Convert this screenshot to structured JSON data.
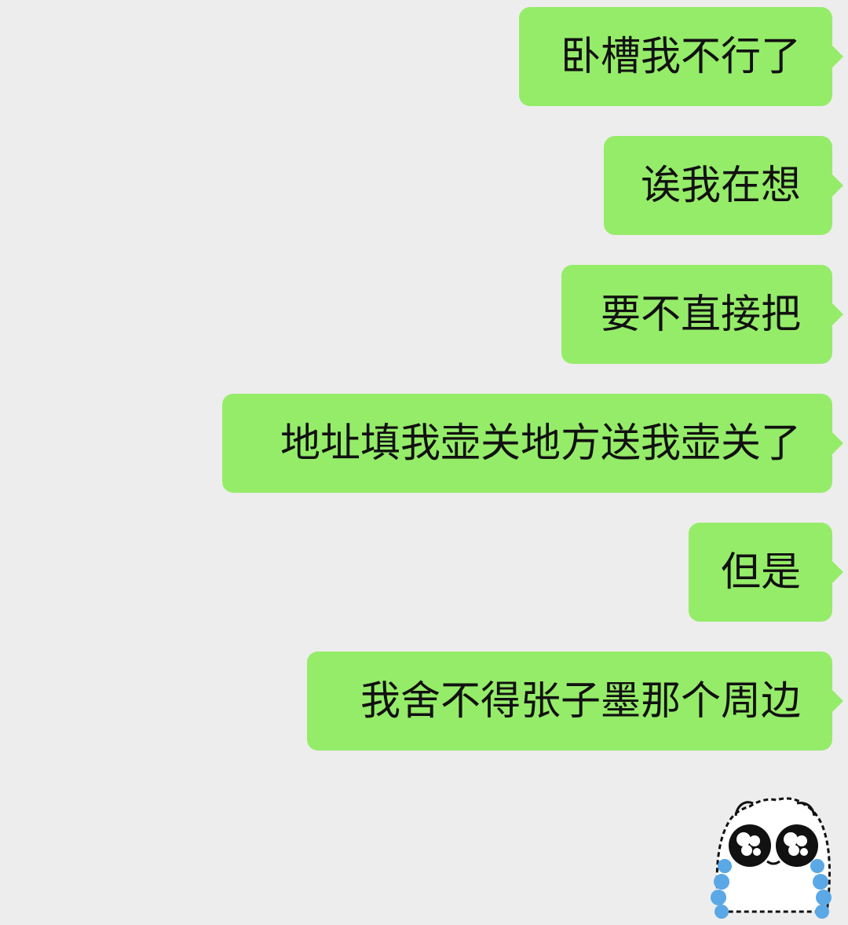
{
  "messages": [
    {
      "text": "卧槽我不行了"
    },
    {
      "text": "诶我在想"
    },
    {
      "text": "要不直接把"
    },
    {
      "text": "地址填我壶关地方送我壶关了"
    },
    {
      "text": "但是"
    },
    {
      "text": "我舍不得张子墨那个周边"
    }
  ],
  "sticker": {
    "icon": "crying-cat-sticker",
    "colors": {
      "face": "#ffffff",
      "outline": "#111111",
      "tears": "#5aa8e6"
    }
  },
  "colors": {
    "background": "#ededed",
    "sent_bubble": "#95ec69",
    "text": "#111111"
  }
}
